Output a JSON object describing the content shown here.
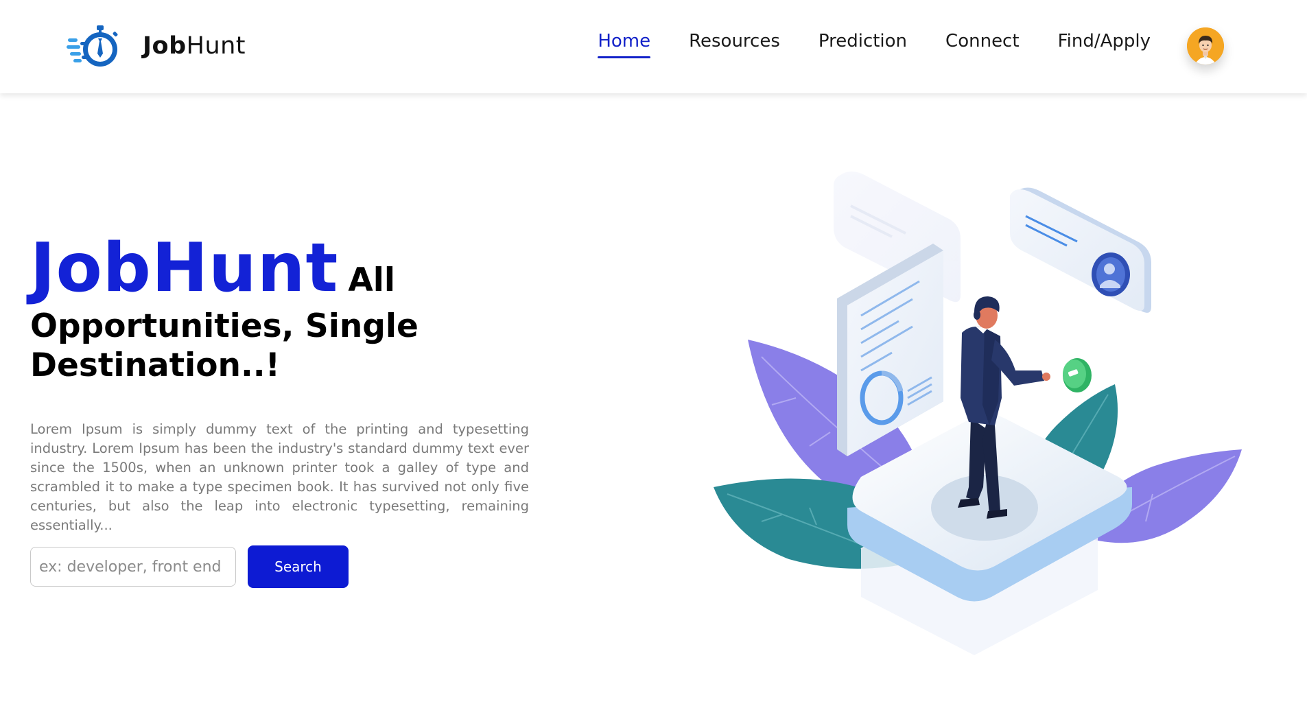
{
  "brand": {
    "name_bold": "Job",
    "name_regular": "Hunt",
    "logo_icon": "stopwatch-tie-icon"
  },
  "nav": {
    "items": [
      {
        "label": "Home",
        "active": true
      },
      {
        "label": "Resources",
        "active": false
      },
      {
        "label": "Prediction",
        "active": false
      },
      {
        "label": "Connect",
        "active": false
      },
      {
        "label": "Find/Apply",
        "active": false
      }
    ],
    "avatar_icon": "user-avatar-icon"
  },
  "hero": {
    "title_big": "JobHunt",
    "title_tag_1": "All",
    "title_tag_2": "Opportunities, Single Destination..!",
    "description": "Lorem Ipsum is simply dummy text of the printing and typesetting industry. Lorem Ipsum has been the industry's standard dummy text ever since the 1500s, when an unknown printer took a galley of type and scrambled it to make a type specimen book. It has survived not only five centuries, but also the leap into electronic typesetting, remaining essentially..."
  },
  "search": {
    "placeholder": "ex: developer, front end",
    "value": "",
    "button_label": "Search"
  },
  "colors": {
    "accent": "#1322d6",
    "button": "#0d1bd3",
    "avatar_bg": "#f5a623",
    "leaf_purple": "#8a7fe8",
    "leaf_teal": "#2a8a94"
  },
  "illustration": {
    "icon": "job-search-isometric-illustration"
  }
}
